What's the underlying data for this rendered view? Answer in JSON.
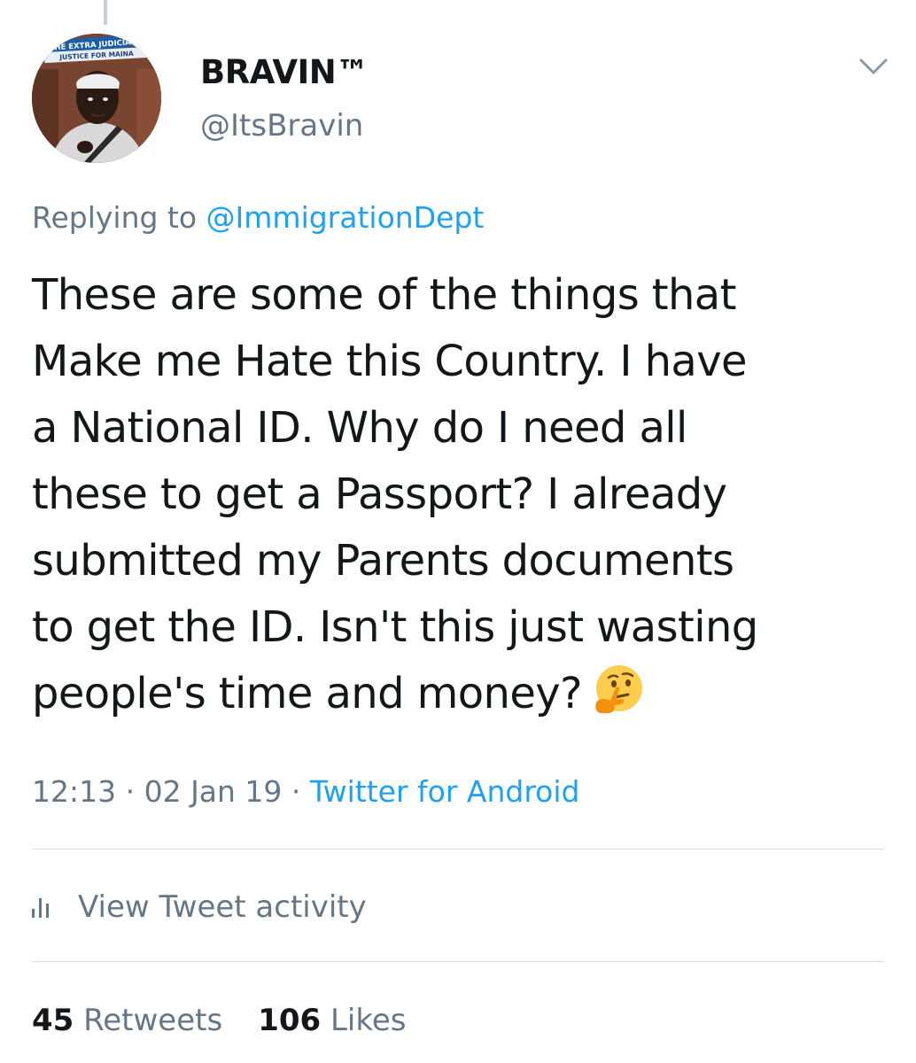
{
  "avatar": {
    "banner_line1": "THE EXTRA JUDICIAL K",
    "banner_line2": "JUSTICE FOR MAINA"
  },
  "author": {
    "display_name": "BRAVIN™",
    "handle": "@ItsBravin"
  },
  "reply": {
    "prefix": "Replying to",
    "mention": "@ImmigrationDept"
  },
  "tweet": {
    "lines": [
      "These are some of the things that",
      "Make me Hate this Country. I have",
      "a National ID. Why do I need all",
      "these to get a Passport? I already",
      "submitted my Parents documents",
      "to get the ID. Isn't this just wasting",
      "people's time and money?"
    ],
    "emoji_icon": "thinking-face-emoji"
  },
  "meta": {
    "time": "12:13",
    "sep1": " · ",
    "date": "02 Jan 19",
    "sep2": " · ",
    "source": "Twitter for Android"
  },
  "activity": {
    "label": "View Tweet activity",
    "icon": "bar-chart-icon"
  },
  "stats": {
    "retweets_count": "45",
    "retweets_label": "Retweets",
    "likes_count": "106",
    "likes_label": "Likes"
  },
  "colors": {
    "link": "#1da1f2",
    "secondary": "#657786",
    "primary_text": "#14171a",
    "divider": "#d8dee3"
  }
}
